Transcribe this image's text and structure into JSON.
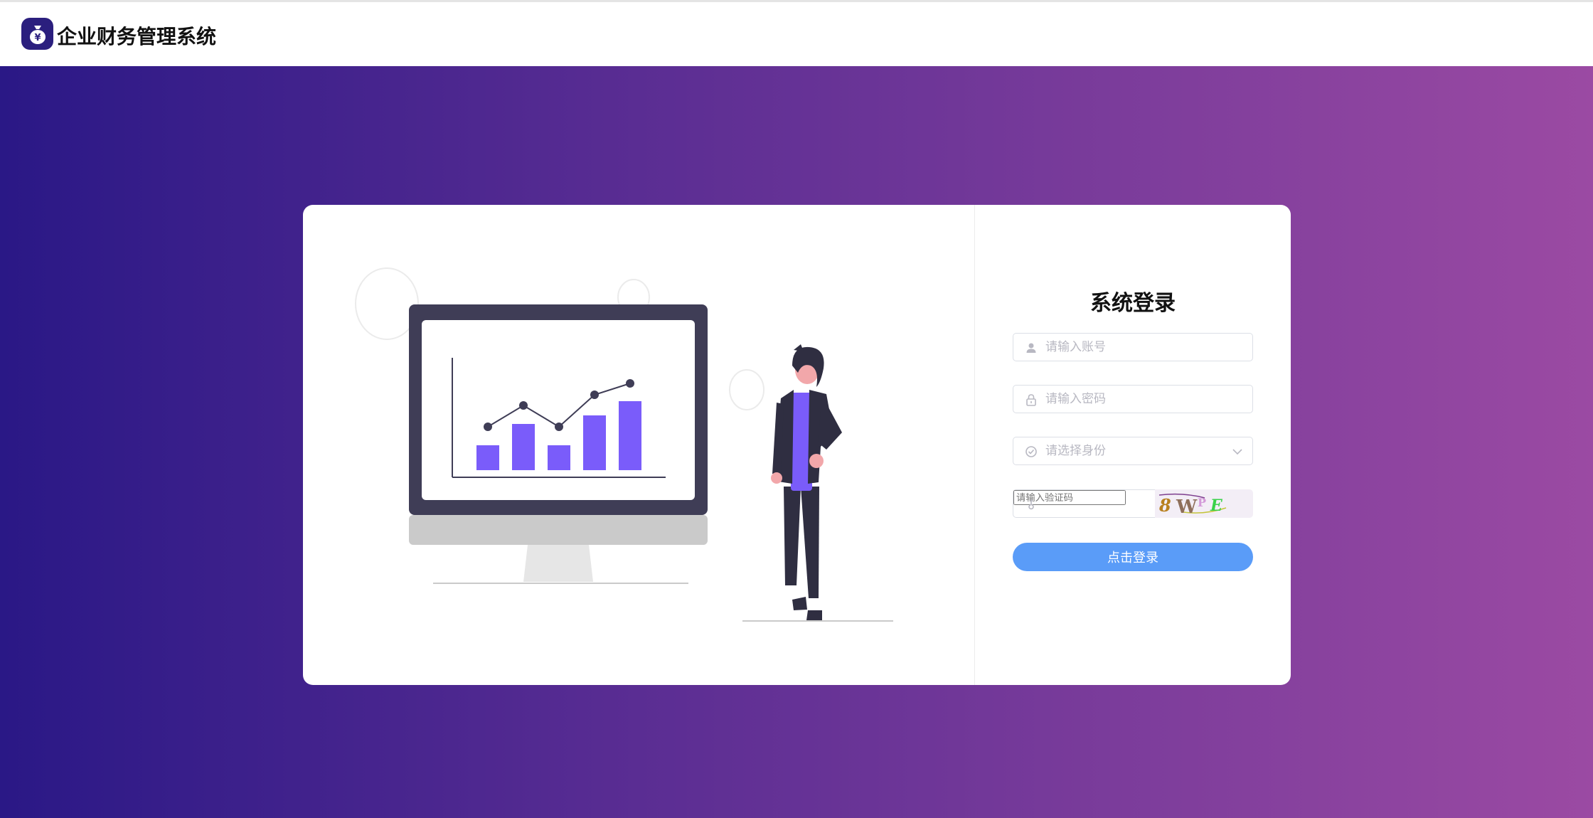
{
  "app": {
    "title": "企业财务管理系统",
    "logo_icon": "money-bag-icon",
    "logo_symbol": "¥"
  },
  "colors": {
    "header_bg": "#ffffff",
    "gradient_start": "#2a1886",
    "gradient_end": "#9b4aa3",
    "accent_purple": "#7a5cfa",
    "submit_blue": "#5a9cf8",
    "logo_bg": "#2b1f7e"
  },
  "login": {
    "title": "系统登录",
    "account": {
      "placeholder": "请输入账号",
      "icon": "user-icon"
    },
    "password": {
      "placeholder": "请输入密码",
      "icon": "lock-icon"
    },
    "role": {
      "placeholder": "请选择身份",
      "icon": "check-circle-icon",
      "dropdown_icon": "chevron-down-icon"
    },
    "captcha": {
      "placeholder": "请输入验证码",
      "icon": "key-icon",
      "code": "8WPE"
    },
    "submit_label": "点击登录"
  },
  "illustration": {
    "name": "analytics-monitor-person",
    "chart_bars": [
      35,
      65,
      35,
      77,
      97
    ],
    "chart_line": [
      48,
      78,
      48,
      93,
      109
    ]
  }
}
